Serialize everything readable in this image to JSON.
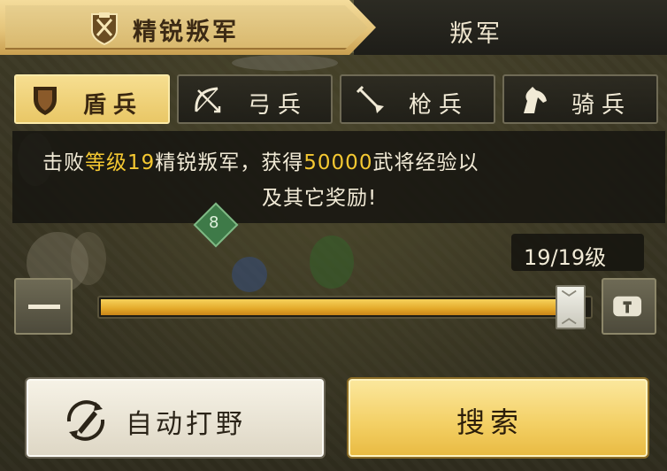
{
  "tabs": {
    "elite_rebels": "精锐叛军",
    "rebels": "叛军"
  },
  "troops": [
    {
      "label": "盾兵",
      "icon": "shield-icon",
      "active": true
    },
    {
      "label": "弓兵",
      "icon": "bow-icon",
      "active": false
    },
    {
      "label": "枪兵",
      "icon": "spear-icon",
      "active": false
    },
    {
      "label": "骑兵",
      "icon": "horse-icon",
      "active": false
    }
  ],
  "info": {
    "prefix": "击败",
    "level_phrase": "等级19",
    "mid": "精锐叛军，获得",
    "exp_amount": "50000",
    "suffix": "武将经验以",
    "line2": "及其它奖励!"
  },
  "map_marker": "8",
  "level": {
    "display": "19/19级",
    "current": 19,
    "max": 19
  },
  "buttons": {
    "auto_hunt": "自动打野",
    "search": "搜索"
  },
  "colors": {
    "highlight": "#f4c832",
    "active_tab": "#e9c766",
    "panel": "#16150f"
  }
}
